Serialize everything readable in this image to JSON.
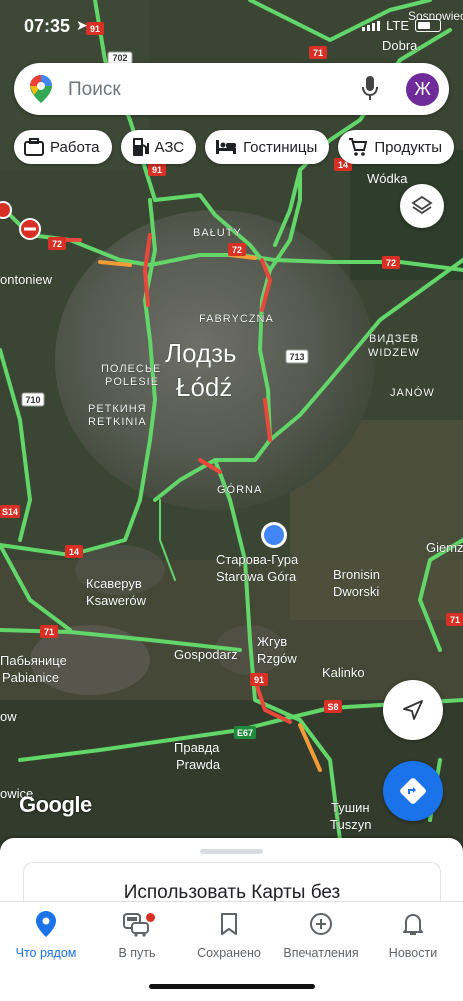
{
  "status": {
    "time": "07:35",
    "network": "LTE"
  },
  "search": {
    "placeholder": "Поиск",
    "avatar_letter": "Ж"
  },
  "chips": [
    "Работа",
    "АЗС",
    "Гостиницы",
    "Продукты"
  ],
  "map": {
    "labels": {
      "dobra": "Dobra",
      "sosnowiec": "Sosnowiec",
      "wodka": "Wódka",
      "baluty": "BAŁUTY",
      "fabryczna": "FABRYCZNA",
      "city_ru": "Лодзь",
      "city_pl": "Łódź",
      "polesie_ru": "ПОЛЕСЬЕ",
      "polesie": "POLESIE",
      "retkinia_ru": "РЕТКИНЯ",
      "retkinia": "RETKINIA",
      "widzew_ru": "ВИДЗЕВ",
      "widzew": "WIDZEW",
      "janow": "JANÓW",
      "gorna": "GÓRNA",
      "starowa_ru": "Старова-Гура",
      "starowa": "Starowa Góra",
      "bronisin": "Bronisin",
      "dworski": "Dworski",
      "ksawerow_ru": "Ксаверув",
      "ksawerow": "Ksawerów",
      "gospodarz": "Gospodarz",
      "rzgow_ru": "Жгув",
      "rzgow": "Rzgów",
      "kalinko": "Kalinko",
      "pabianice_ru": "Пабьянице",
      "pabianice": "Pabianice",
      "pravda_ru": "Правда",
      "prawda": "Prawda",
      "tuszyn_ru": "Тушин",
      "tuszyn": "Tuszyn",
      "tomiew": "ontoniew",
      "giemz": "Giemz",
      "ow": "ow",
      "owice": "owice"
    },
    "shields": {
      "r702": "702",
      "r71a": "71",
      "r72a": "72",
      "r72b": "72",
      "r72c": "72",
      "r91a": "91",
      "r91b": "91",
      "r14a": "14",
      "r14b": "14",
      "r710": "710",
      "r713": "713",
      "rS14": "S14",
      "r71b": "71",
      "rE67": "E67",
      "rS8": "S8",
      "r91c": "91",
      "r71c": "71"
    },
    "google": "Google"
  },
  "sheet": {
    "card_text": "Использовать Карты без"
  },
  "nav": [
    {
      "label": "Что рядом",
      "icon": "location-pin-icon",
      "active": true
    },
    {
      "label": "В путь",
      "icon": "commute-icon",
      "active": false
    },
    {
      "label": "Сохранено",
      "icon": "bookmark-icon",
      "active": false
    },
    {
      "label": "Впечатления",
      "icon": "add-circle-icon",
      "active": false
    },
    {
      "label": "Новости",
      "icon": "bell-icon",
      "active": false
    }
  ],
  "colors": {
    "accent": "#1a73e8",
    "traffic_green": "#63d66a",
    "traffic_red": "#e8483c",
    "avatar": "#6f2b9a"
  }
}
